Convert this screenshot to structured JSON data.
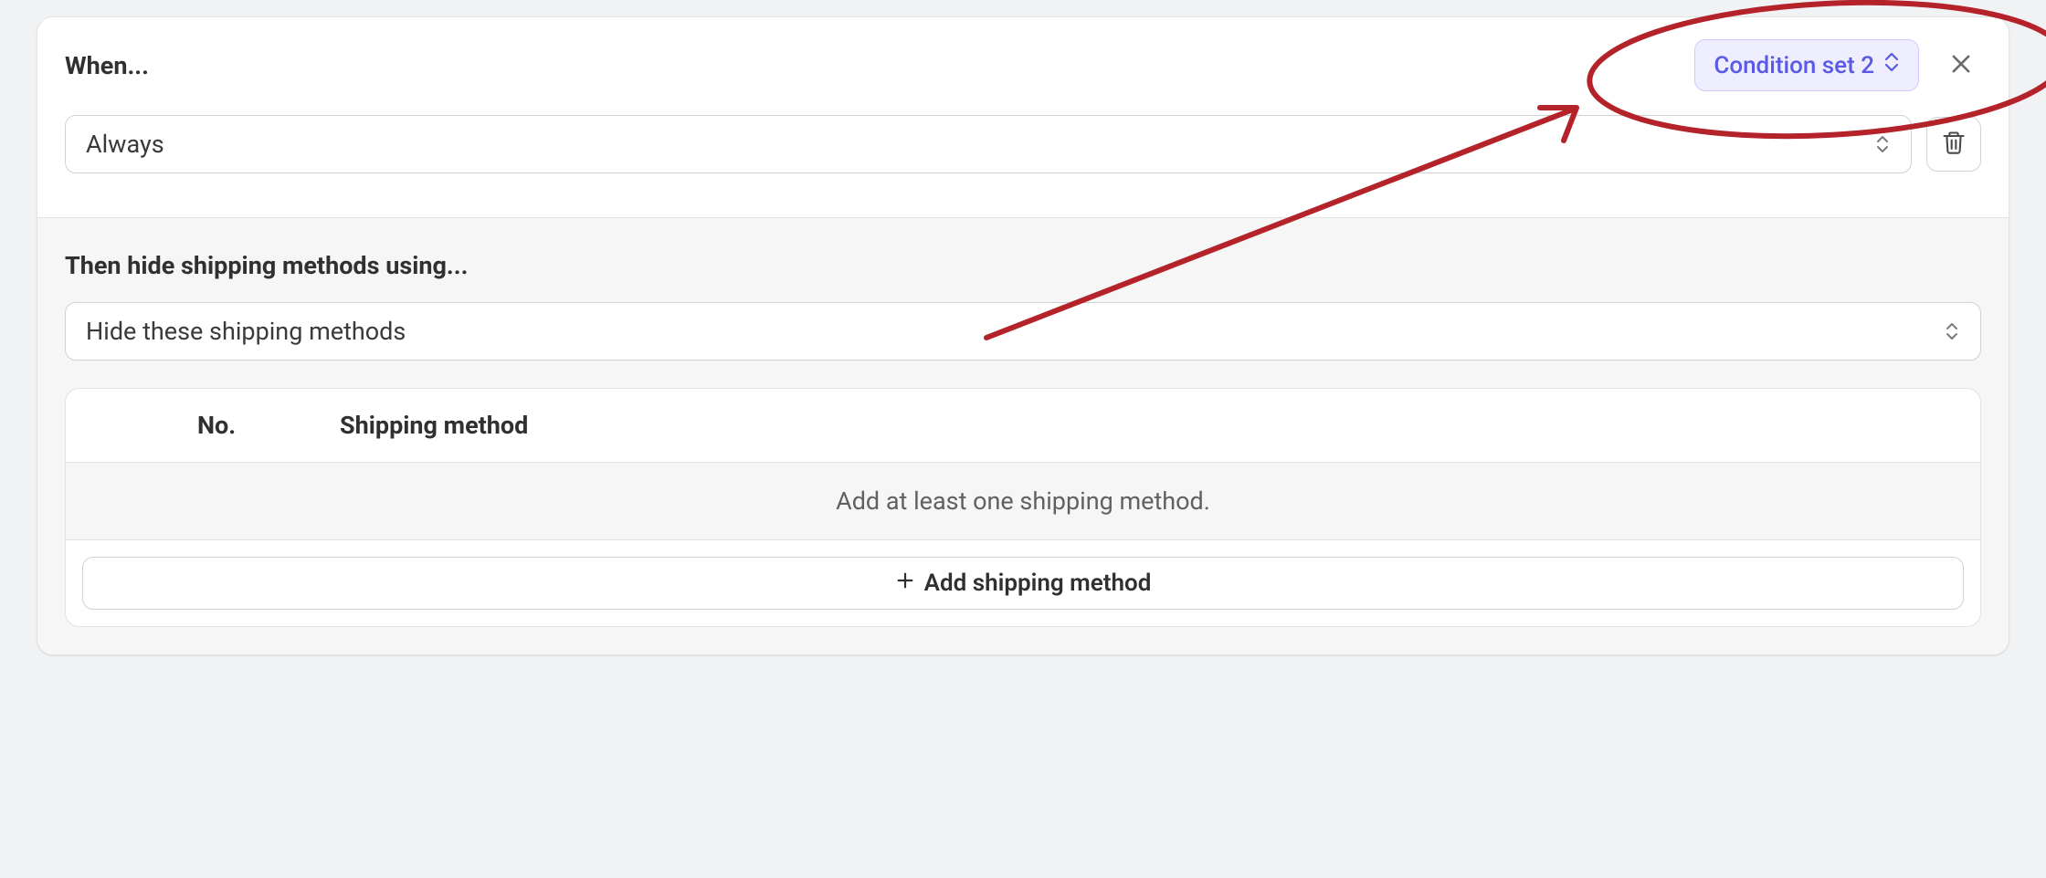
{
  "when": {
    "title": "When...",
    "condition_select": "Always",
    "badge_label": "Condition set 2"
  },
  "then": {
    "title": "Then hide shipping methods using...",
    "action_select": "Hide these shipping methods",
    "table": {
      "col_no": "No.",
      "col_method": "Shipping method",
      "empty_message": "Add at least one shipping method.",
      "add_button": "Add shipping method"
    }
  }
}
